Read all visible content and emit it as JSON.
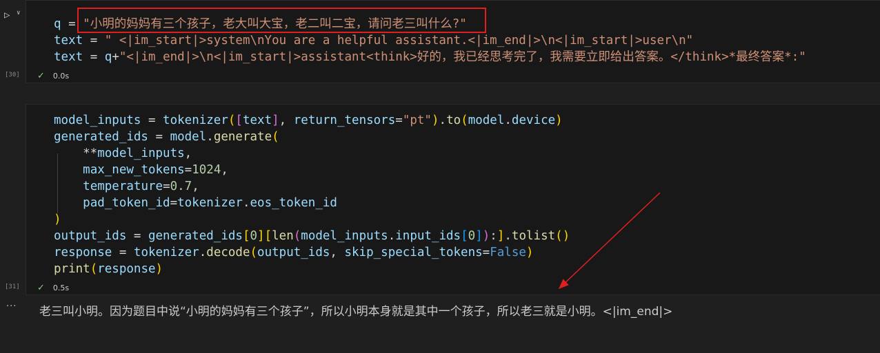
{
  "cell1": {
    "exec_count": "[30]",
    "status_time": "0.0s",
    "lines": [
      [
        [
          "q",
          "var"
        ],
        [
          " = ",
          "op"
        ],
        [
          "\"小明的妈妈有三个孩子，老大叫大宝，老二叫二宝，请问老三叫什么?\"",
          "str"
        ]
      ],
      [
        [
          "text",
          "var"
        ],
        [
          " = ",
          "op"
        ],
        [
          "\" <|im_start|>system\\nYou are a helpful assistant.<|im_end|>\\n<|im_start|>user\\n\"",
          "str"
        ]
      ],
      [
        [
          "text",
          "var"
        ],
        [
          " = ",
          "op"
        ],
        [
          "q",
          "var"
        ],
        [
          "+",
          "op"
        ],
        [
          "\"<|im_end|>\\n<|im_start|>assistant<think>好的，我已经思考完了，我需要立即给出答案。</think>*最终答案*:\"",
          "str"
        ]
      ]
    ]
  },
  "cell2": {
    "exec_count": "[31]",
    "status_time": "0.5s",
    "lines": [
      [
        [
          "model_inputs",
          "var"
        ],
        [
          " = ",
          "op"
        ],
        [
          "tokenizer",
          "var"
        ],
        [
          "(",
          "b1"
        ],
        [
          "[",
          "b2"
        ],
        [
          "text",
          "var"
        ],
        [
          "]",
          "b2"
        ],
        [
          ", ",
          "op"
        ],
        [
          "return_tensors",
          "var"
        ],
        [
          "=",
          "op"
        ],
        [
          "\"pt\"",
          "str"
        ],
        [
          ")",
          "b1"
        ],
        [
          ".",
          "op"
        ],
        [
          "to",
          "fn"
        ],
        [
          "(",
          "b1"
        ],
        [
          "model",
          "var"
        ],
        [
          ".",
          "op"
        ],
        [
          "device",
          "var"
        ],
        [
          ")",
          "b1"
        ]
      ],
      [
        [
          "generated_ids",
          "var"
        ],
        [
          " = ",
          "op"
        ],
        [
          "model",
          "var"
        ],
        [
          ".",
          "op"
        ],
        [
          "generate",
          "fn"
        ],
        [
          "(",
          "b1"
        ]
      ],
      [
        [
          "    **",
          "op"
        ],
        [
          "model_inputs",
          "var"
        ],
        [
          ",",
          "op"
        ]
      ],
      [
        [
          "    ",
          "op"
        ],
        [
          "max_new_tokens",
          "var"
        ],
        [
          "=",
          "op"
        ],
        [
          "1024",
          "num"
        ],
        [
          ",",
          "op"
        ]
      ],
      [
        [
          "    ",
          "op"
        ],
        [
          "temperature",
          "var"
        ],
        [
          "=",
          "op"
        ],
        [
          "0.7",
          "num"
        ],
        [
          ",",
          "op"
        ]
      ],
      [
        [
          "    ",
          "op"
        ],
        [
          "pad_token_id",
          "var"
        ],
        [
          "=",
          "op"
        ],
        [
          "tokenizer",
          "var"
        ],
        [
          ".",
          "op"
        ],
        [
          "eos_token_id",
          "var"
        ]
      ],
      [
        [
          ")",
          "b1"
        ]
      ],
      [
        [
          "output_ids",
          "var"
        ],
        [
          " = ",
          "op"
        ],
        [
          "generated_ids",
          "var"
        ],
        [
          "[",
          "b1"
        ],
        [
          "0",
          "num"
        ],
        [
          "]",
          "b1"
        ],
        [
          "[",
          "b1"
        ],
        [
          "len",
          "fn"
        ],
        [
          "(",
          "b2"
        ],
        [
          "model_inputs",
          "var"
        ],
        [
          ".",
          "op"
        ],
        [
          "input_ids",
          "var"
        ],
        [
          "[",
          "b3"
        ],
        [
          "0",
          "num"
        ],
        [
          "]",
          "b3"
        ],
        [
          ")",
          "b2"
        ],
        [
          ":",
          "op"
        ],
        [
          "]",
          "b1"
        ],
        [
          ".",
          "op"
        ],
        [
          "tolist",
          "fn"
        ],
        [
          "(",
          "b1"
        ],
        [
          ")",
          "b1"
        ]
      ],
      [
        [
          "response",
          "var"
        ],
        [
          " = ",
          "op"
        ],
        [
          "tokenizer",
          "var"
        ],
        [
          ".",
          "op"
        ],
        [
          "decode",
          "fn"
        ],
        [
          "(",
          "b1"
        ],
        [
          "output_ids",
          "var"
        ],
        [
          ", ",
          "op"
        ],
        [
          "skip_special_tokens",
          "var"
        ],
        [
          "=",
          "op"
        ],
        [
          "False",
          "kw"
        ],
        [
          ")",
          "b1"
        ]
      ],
      [
        [
          "print",
          "fn"
        ],
        [
          "(",
          "b1"
        ],
        [
          "response",
          "var"
        ],
        [
          ")",
          "b1"
        ]
      ]
    ]
  },
  "output": {
    "ellipsis": "···",
    "text": "老三叫小明。因为题目中说“小明的妈妈有三个孩子”，所以小明本身就是其中一个孩子，所以老三就是小明。<|im_end|>"
  },
  "icons": {
    "run": "run-icon",
    "run_menu": "chevron-down-icon",
    "check": "check-icon"
  },
  "colors": {
    "annotation": "#e02020",
    "check": "#89d185"
  }
}
